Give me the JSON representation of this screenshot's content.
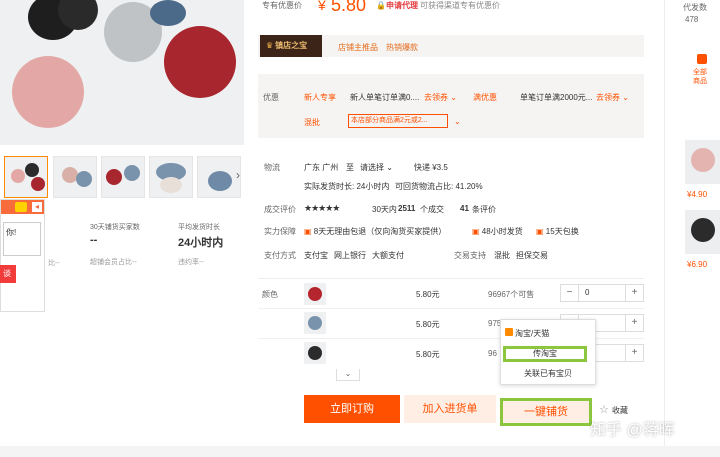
{
  "price_bar": {
    "promo_label": "专有优惠价",
    "currency": "¥",
    "price": "5.80",
    "apply_agent": "申请代理",
    "apply_note": "可获得渠道专有优惠价"
  },
  "shop": {
    "badge": "镇店之宝",
    "desc": "店铺主推品",
    "hot": "热销爆款"
  },
  "coupons": {
    "label": "优惠",
    "new_user_tag": "新人专享",
    "new_user_text": "新人单笔订单满0....",
    "new_user_claim": "去领券",
    "full_tag": "满优惠",
    "full_text": "单笔订单满2000元...",
    "full_claim": "去领券",
    "mix_tag": "混批",
    "mix_text": "本店部分商品满2元或2..."
  },
  "shipping": {
    "label": "物流",
    "from": "广东 广州",
    "to_word": "至",
    "to_select": "请选择",
    "express": "快递 ¥3.5",
    "ship_time": "实际发货时长: 24小时内",
    "retention": "可回货物流占比: 41.20%"
  },
  "reviews": {
    "label": "成交评价",
    "stars": "★★★★★",
    "deals_prefix": "30天内",
    "deals_num": "2511",
    "deals_suffix": "个成交",
    "review_num": "41",
    "review_suffix": "条评价"
  },
  "guarantee": {
    "label": "实力保障",
    "item1": "8天无理由包退（仅向淘货买家提供）",
    "item2": "48小时发货",
    "item3": "15天包换"
  },
  "payment": {
    "label": "支付方式",
    "methods": [
      "支付宝",
      "网上银行",
      "大额支付"
    ],
    "trade_label": "交易支持",
    "trade_methods": [
      "混批",
      "担保交易"
    ]
  },
  "sku": {
    "label": "颜色",
    "rows": [
      {
        "price": "5.80元",
        "stock": "96967个可售",
        "qty": "0",
        "color": "#b4252e"
      },
      {
        "price": "5.80元",
        "stock": "975",
        "qty": "0",
        "color": "#7a93ad"
      },
      {
        "price": "5.80元",
        "stock": "96",
        "qty": "0",
        "color": "#2b2b2b"
      }
    ],
    "expand": "⌄"
  },
  "actions": {
    "buy_now": "立即订购",
    "add_stock": "加入进货单",
    "one_click": "一键铺货",
    "favorite": "收藏"
  },
  "popup": {
    "title": "淘宝/天猫",
    "option1": "传淘宝",
    "option2": "关联已有宝贝"
  },
  "left_stats": {
    "stat1_label": "30天铺货买家数",
    "stat1_value": "--",
    "stat1_sub": "超铺会员占比--",
    "stat2_label": "平均发货时长",
    "stat2_value": "24小时内",
    "stat2_sub": "违约率--",
    "left_sub": "比--",
    "chat_input": "你!",
    "chat_btn": "谈"
  },
  "right_col": {
    "top_label": "代发数",
    "top_num": "478",
    "all_label": "全部商品",
    "prices": [
      "¥4.90",
      "¥6.90"
    ]
  },
  "watermark": "知乎 @蒋晖",
  "colors": {
    "accent": "#ff5000",
    "highlight": "#8cc63f",
    "shop_dark": "#3c2418"
  }
}
